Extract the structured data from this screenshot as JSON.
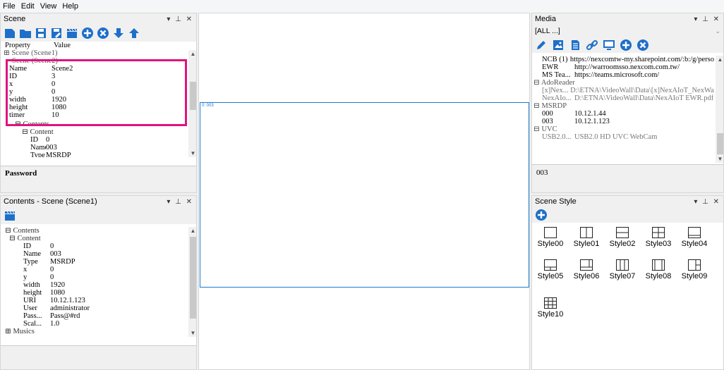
{
  "menu": [
    "File",
    "Edit",
    "View",
    "Help"
  ],
  "scene_panel": {
    "title": "Scene",
    "controls": "▾ ꟹ ✕",
    "header_property": "Property",
    "header_value": "Value",
    "root_label": "Scene (Scene1)",
    "group_label": "Scene (Scene2)",
    "rows": [
      {
        "k": "Name",
        "v": "Scene2"
      },
      {
        "k": "ID",
        "v": "3"
      },
      {
        "k": "x",
        "v": "0"
      },
      {
        "k": "y",
        "v": "0"
      },
      {
        "k": "width",
        "v": "1920"
      },
      {
        "k": "height",
        "v": "1080"
      },
      {
        "k": "timer",
        "v": "10"
      }
    ],
    "contents_label": "Contents",
    "content_label": "Content",
    "sub_rows": [
      {
        "k": "ID",
        "v": "0"
      },
      {
        "k": "Name",
        "v": "003"
      },
      {
        "k": "Type",
        "v": "MSRDP"
      }
    ],
    "description": "Password",
    "highlight_color": "#e0137e"
  },
  "contents_panel": {
    "title": "Contents - Scene (Scene1)",
    "tree_root": "Contents",
    "tree_content": "Content",
    "rows": [
      {
        "k": "ID",
        "v": "0"
      },
      {
        "k": "Name",
        "v": "003"
      },
      {
        "k": "Type",
        "v": "MSRDP"
      },
      {
        "k": "x",
        "v": "0"
      },
      {
        "k": "y",
        "v": "0"
      },
      {
        "k": "width",
        "v": "1920"
      },
      {
        "k": "height",
        "v": "1080"
      },
      {
        "k": "URI",
        "v": "10.12.1.123"
      },
      {
        "k": "User",
        "v": "administrator"
      },
      {
        "k": "Pass...",
        "v": "Pass@#rd"
      },
      {
        "k": "Scal...",
        "v": "1.0"
      }
    ],
    "musics": "Musics"
  },
  "canvas": {
    "content_label": "0: 003",
    "border_color": "#1e7bd1"
  },
  "media_panel": {
    "title": "Media",
    "filter": "[ALL ...]",
    "items": [
      {
        "k": "NCB (1)",
        "v": "https://nexcomtw-my.sharepoint.com/:b:/g/personal/cl..."
      },
      {
        "k": "EWR",
        "v": "http://warroomsso.nexcom.com.tw/"
      },
      {
        "k": "MS Tea...",
        "v": "https://teams.microsoft.com/"
      }
    ],
    "group_adoreader": "AdoReader",
    "ado_items": [
      {
        "k": "[x]Nex...",
        "v": "D:\\ETNA\\VideoWall\\Data\\[x]NexAIoT_NexWall_Pu..."
      },
      {
        "k": "NexAIo...",
        "v": "D:\\ETNA\\VideoWall\\Data\\NexAIoT EWR.pdf"
      }
    ],
    "group_msrdp": "MSRDP",
    "rdp_items": [
      {
        "k": "000",
        "v": "10.12.1.44"
      },
      {
        "k": "003",
        "v": "10.12.1.123"
      }
    ],
    "group_uvc": "UVC",
    "uvc_items": [
      {
        "k": "USB2.0...",
        "v": "USB2.0 HD UVC WebCam"
      }
    ],
    "selected": "003"
  },
  "style_panel": {
    "title": "Scene Style",
    "styles": [
      "Style00",
      "Style01",
      "Style02",
      "Style03",
      "Style04",
      "Style05",
      "Style06",
      "Style07",
      "Style08",
      "Style09",
      "Style10"
    ]
  },
  "icon_color": "#1e6fc9"
}
